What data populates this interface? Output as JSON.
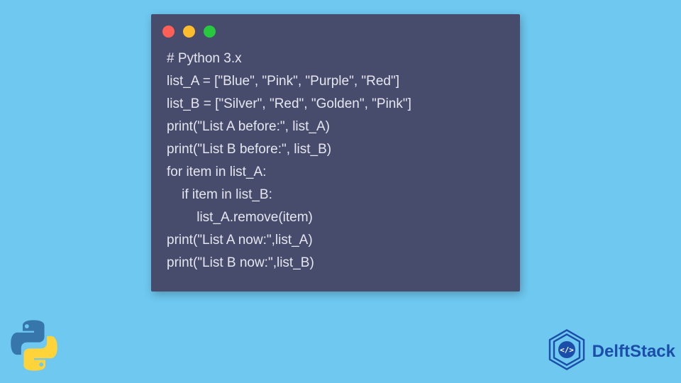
{
  "code_lines": [
    "# Python 3.x",
    "list_A = [\"Blue\", \"Pink\", \"Purple\", \"Red\"]",
    "list_B = [\"Silver\", \"Red\", \"Golden\", \"Pink\"]",
    "print(\"List A before:\", list_A)",
    "print(\"List B before:\", list_B)",
    "for item in list_A:",
    "    if item in list_B:",
    "        list_A.remove(item)",
    "print(\"List A now:\",list_A)",
    "print(\"List B now:\",list_B)"
  ],
  "brand": {
    "name": "DelftStack"
  }
}
